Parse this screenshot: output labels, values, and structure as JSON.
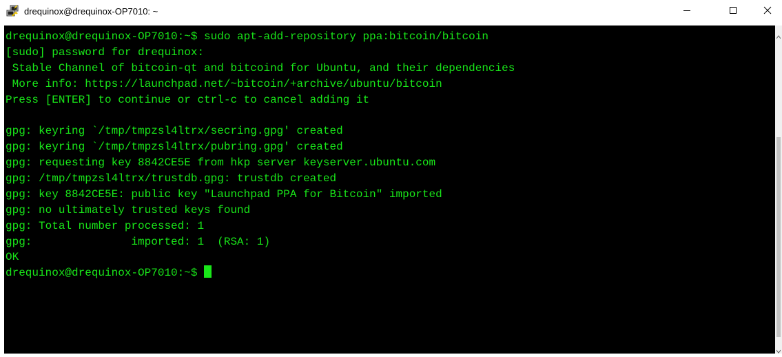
{
  "window": {
    "title": "drequinox@drequinox-OP7010: ~",
    "icon": "putty-icon",
    "controls": {
      "minimize": "minimize-icon",
      "maximize": "maximize-icon",
      "close": "close-icon"
    }
  },
  "terminal": {
    "text_color": "#19e619",
    "background": "#000000",
    "lines": [
      "drequinox@drequinox-OP7010:~$ sudo apt-add-repository ppa:bitcoin/bitcoin",
      "[sudo] password for drequinox:",
      " Stable Channel of bitcoin-qt and bitcoind for Ubuntu, and their dependencies",
      " More info: https://launchpad.net/~bitcoin/+archive/ubuntu/bitcoin",
      "Press [ENTER] to continue or ctrl-c to cancel adding it",
      "",
      "gpg: keyring `/tmp/tmpzsl4ltrx/secring.gpg' created",
      "gpg: keyring `/tmp/tmpzsl4ltrx/pubring.gpg' created",
      "gpg: requesting key 8842CE5E from hkp server keyserver.ubuntu.com",
      "gpg: /tmp/tmpzsl4ltrx/trustdb.gpg: trustdb created",
      "gpg: key 8842CE5E: public key \"Launchpad PPA for Bitcoin\" imported",
      "gpg: no ultimately trusted keys found",
      "gpg: Total number processed: 1",
      "gpg:               imported: 1  (RSA: 1)",
      "OK"
    ],
    "prompt": "drequinox@drequinox-OP7010:~$ "
  }
}
